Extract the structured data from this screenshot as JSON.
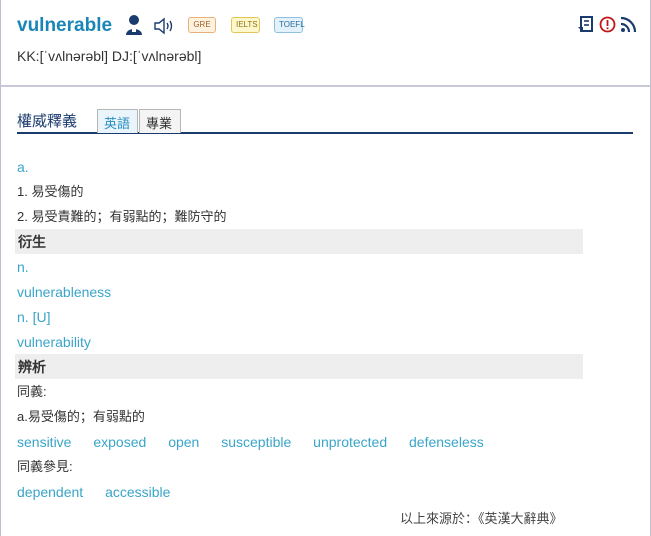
{
  "entry": {
    "word": "vulnerable",
    "pronunciation": "KK:[ˈvʌlnərəbl] DJ:[ˈvʌlnərəbl]",
    "badges": {
      "gre": "GRE",
      "ielts": "IELTS",
      "toefl": "TOEFL"
    },
    "icons": {
      "person": "user-icon",
      "speaker": "speaker-icon",
      "save": "save-note-icon",
      "report": "report-error-icon",
      "rss": "rss-icon"
    }
  },
  "tabs": {
    "title": "權威釋義",
    "items": [
      "英語",
      "專業"
    ],
    "active": "英語"
  },
  "definitions": {
    "pos": "a.",
    "senses": [
      "1. 易受傷的",
      "2. 易受責難的；有弱點的；難防守的"
    ]
  },
  "derivation": {
    "heading": "衍生",
    "items": [
      {
        "pos": "n.",
        "word": "vulnerableness"
      },
      {
        "pos": "n. [U]",
        "word": "vulnerability"
      }
    ]
  },
  "analysis": {
    "heading": "辨析",
    "synonym_label": "同義:",
    "sense": "a.易受傷的；有弱點的",
    "synonyms": [
      "sensitive",
      "exposed",
      "open",
      "susceptible",
      "unprotected",
      "defenseless"
    ],
    "see_also_label": "同義參見:",
    "see_also": [
      "dependent",
      "accessible"
    ]
  },
  "source": "以上來源於：《英漢大辭典》",
  "colors": {
    "accent": "#1a86b8",
    "link": "#3aa5c8",
    "tab_border": "#1a3b6e",
    "section_bg": "#eeeeee"
  }
}
